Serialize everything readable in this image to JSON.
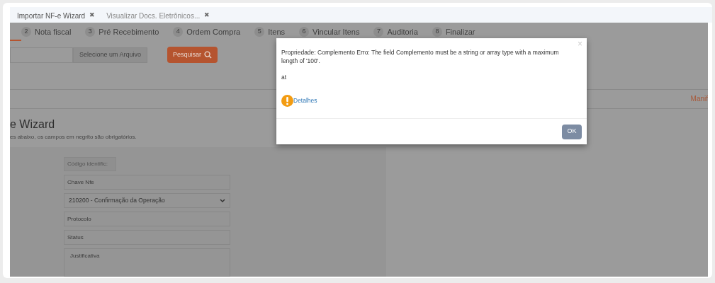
{
  "tabs": [
    {
      "label": "Importar NF-e Wizard",
      "close": "✖",
      "selected": true
    },
    {
      "label": "Visualizar Docs. Eletrônicos...",
      "close": "✖",
      "selected": false
    }
  ],
  "steps": [
    {
      "number": "2",
      "label": "Nota fiscal"
    },
    {
      "number": "3",
      "label": "Pré Recebimento"
    },
    {
      "number": "4",
      "label": "Ordem Compra"
    },
    {
      "number": "5",
      "label": "Itens"
    },
    {
      "number": "6",
      "label": "Vincular Itens"
    },
    {
      "number": "7",
      "label": "Auditoria"
    },
    {
      "number": "8",
      "label": "Finalizar"
    }
  ],
  "file_button": "Selecione um Arquivo",
  "search_button": "Pesquisar",
  "side_link": "Manif",
  "heading": "e Wizard",
  "subtitle": "es abaixo, os campos em negrito são obrigatórios.",
  "form": {
    "code_button": "Código identific:",
    "fields": [
      {
        "kind": "input",
        "placeholder": "Chave Nfe"
      },
      {
        "kind": "select",
        "value": "210200 - Confirmação da Operação"
      },
      {
        "kind": "input",
        "placeholder": "Protocolo"
      },
      {
        "kind": "input",
        "placeholder": "Status"
      },
      {
        "kind": "textarea",
        "placeholder": "Justificativa"
      }
    ]
  },
  "dialog": {
    "close": "×",
    "message": "Propriedade: Complemento Erro: The field Complemento must be a string or array type with a maximum length of '100'.",
    "trace": "at",
    "details_link": "Detalhes",
    "ok_button": "OK"
  }
}
